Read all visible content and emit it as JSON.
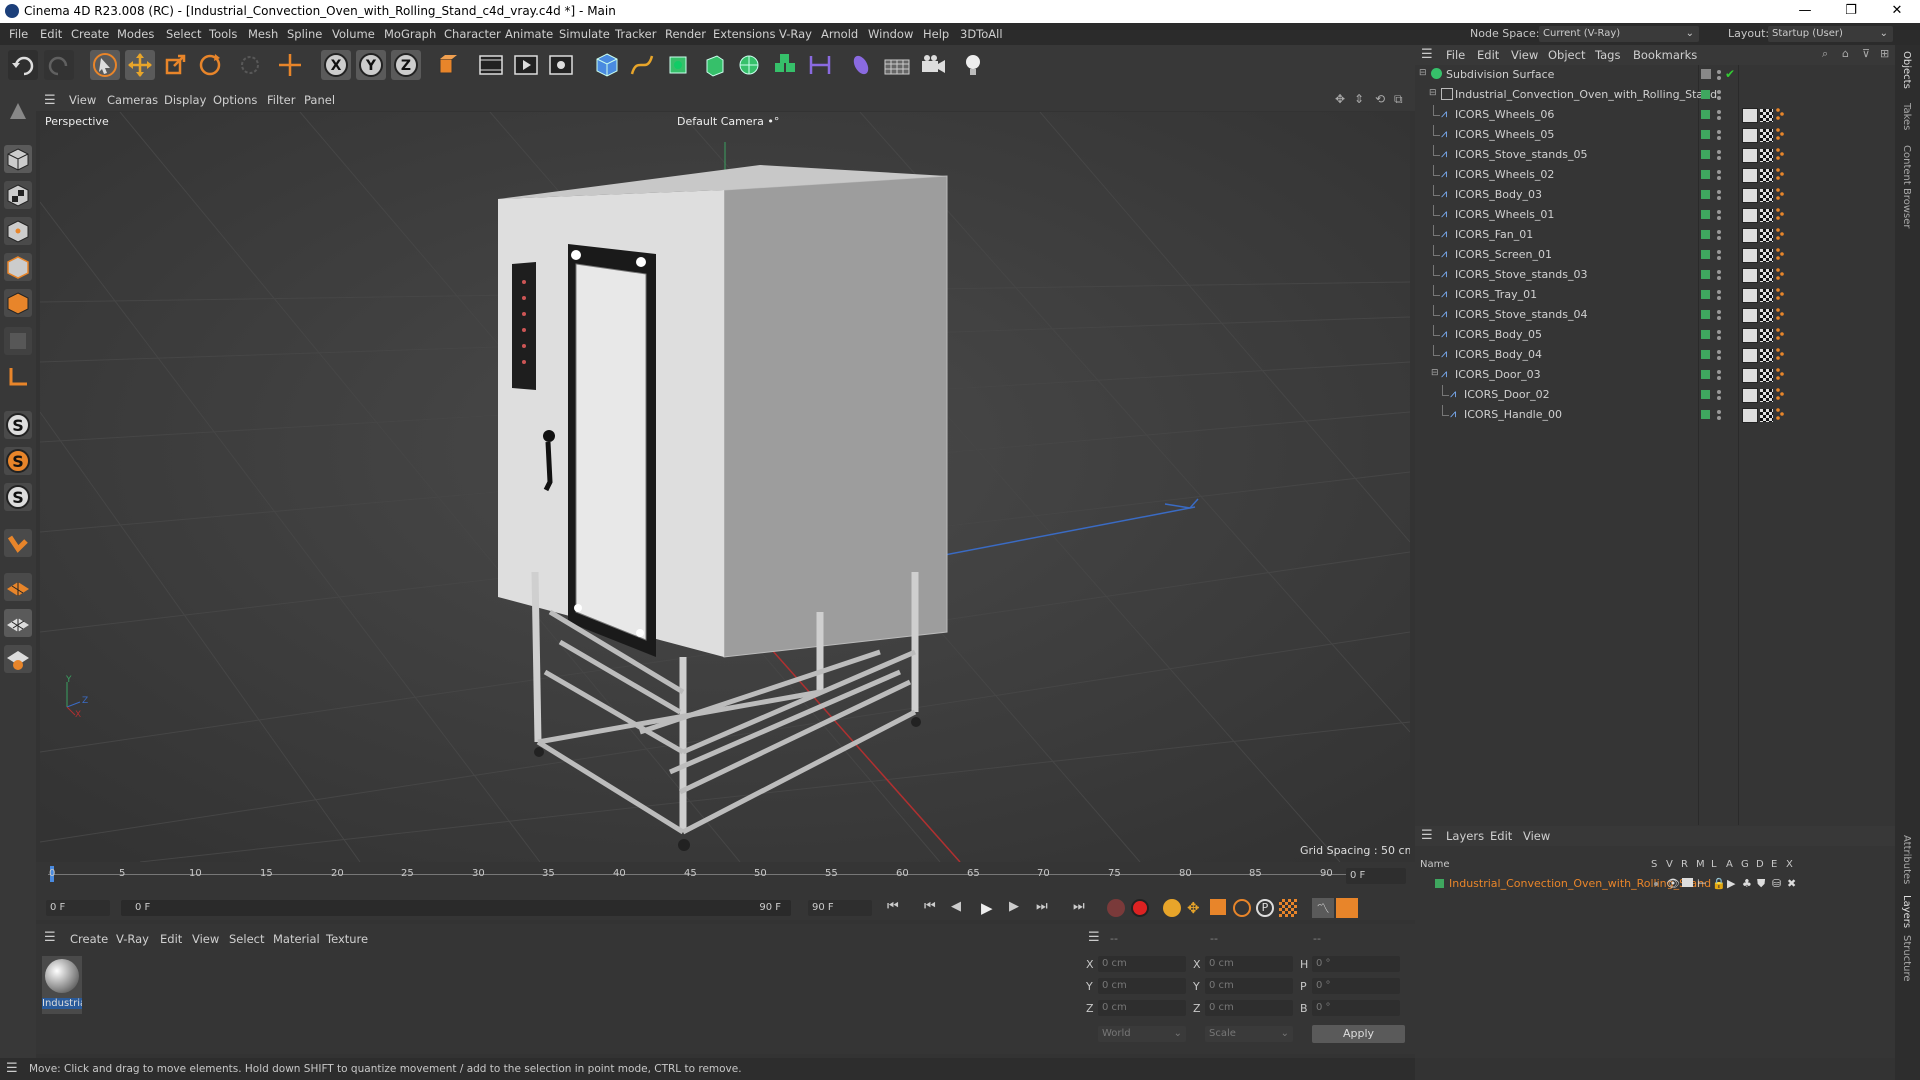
{
  "window": {
    "title": "Cinema 4D R23.008 (RC) - [Industrial_Convection_Oven_with_Rolling_Stand_c4d_vray.c4d *] - Main",
    "minimize": "—",
    "maximize": "❐",
    "close": "✕"
  },
  "menubar": [
    "File",
    "Edit",
    "Create",
    "Modes",
    "Select",
    "Tools",
    "Mesh",
    "Spline",
    "Volume",
    "MoGraph",
    "Character",
    "Animate",
    "Simulate",
    "Tracker",
    "Render",
    "Extensions",
    "V-Ray",
    "Arnold",
    "Window",
    "Help",
    "3DToAll"
  ],
  "node_space": {
    "label": "Node Space:",
    "value": "Current (V-Ray)"
  },
  "layout": {
    "label": "Layout:",
    "value": "Startup (User)"
  },
  "viewport": {
    "menu": [
      "View",
      "Cameras",
      "Display",
      "Options",
      "Filter",
      "Panel"
    ],
    "label": "Perspective",
    "camera": "Default Camera",
    "camera_icon": "•°",
    "grid_spacing": "Grid Spacing : 50 cm",
    "axis": {
      "y": "Y",
      "z": "Z",
      "x": "X"
    }
  },
  "timeline": {
    "ticks": [
      "0",
      "5",
      "10",
      "15",
      "20",
      "25",
      "30",
      "35",
      "40",
      "45",
      "50",
      "55",
      "60",
      "65",
      "70",
      "75",
      "80",
      "85",
      "90"
    ],
    "frame_end_field": "0 F",
    "current_frame": "0 F",
    "range_start": "0 F",
    "range_end": "90 F",
    "max_frame": "90 F"
  },
  "material_manager": {
    "menu": [
      "Create",
      "V-Ray",
      "Edit",
      "View",
      "Select",
      "Material",
      "Texture"
    ],
    "material_label": "Industria"
  },
  "coordinates": {
    "headers": [
      "--",
      "--",
      "--"
    ],
    "rows": [
      {
        "a": "X",
        "av": "0 cm",
        "b": "X",
        "bv": "0 cm",
        "c": "H",
        "cv": "0 °"
      },
      {
        "a": "Y",
        "av": "0 cm",
        "b": "Y",
        "bv": "0 cm",
        "c": "P",
        "cv": "0 °"
      },
      {
        "a": "Z",
        "av": "0 cm",
        "b": "Z",
        "bv": "0 cm",
        "c": "B",
        "cv": "0 °"
      }
    ],
    "world": "World",
    "scale": "Scale",
    "apply": "Apply"
  },
  "status": "Move: Click and drag to move elements. Hold down SHIFT to quantize movement / add to the selection in point mode, CTRL to remove.",
  "object_manager": {
    "menu": [
      "File",
      "Edit",
      "View",
      "Object",
      "Tags",
      "Bookmarks"
    ],
    "root": "Subdivision Surface",
    "group": "Industrial_Convection_Oven_with_Rolling_Stand",
    "objects": [
      "ICORS_Wheels_06",
      "ICORS_Wheels_05",
      "ICORS_Stove_stands_05",
      "ICORS_Wheels_02",
      "ICORS_Body_03",
      "ICORS_Wheels_01",
      "ICORS_Fan_01",
      "ICORS_Screen_01",
      "ICORS_Stove_stands_03",
      "ICORS_Tray_01",
      "ICORS_Stove_stands_04",
      "ICORS_Body_05",
      "ICORS_Body_04",
      "ICORS_Door_03"
    ],
    "children": [
      "ICORS_Door_02",
      "ICORS_Handle_00"
    ]
  },
  "layer_manager": {
    "menu": [
      "Layers",
      "Edit",
      "View"
    ],
    "name_header": "Name",
    "col_headers": [
      "S",
      "V",
      "R",
      "M",
      "L",
      "A",
      "G",
      "D",
      "E",
      "X"
    ],
    "layer": "Industrial_Convection_Oven_with_Rolling_Stand"
  },
  "right_tabs": [
    "Objects",
    "Takes",
    "Content Browser",
    "Attributes",
    "Layers",
    "Structure"
  ],
  "colors": {
    "accent": "#e8852a",
    "green": "#3fa75f",
    "blue": "#4a8be0"
  }
}
